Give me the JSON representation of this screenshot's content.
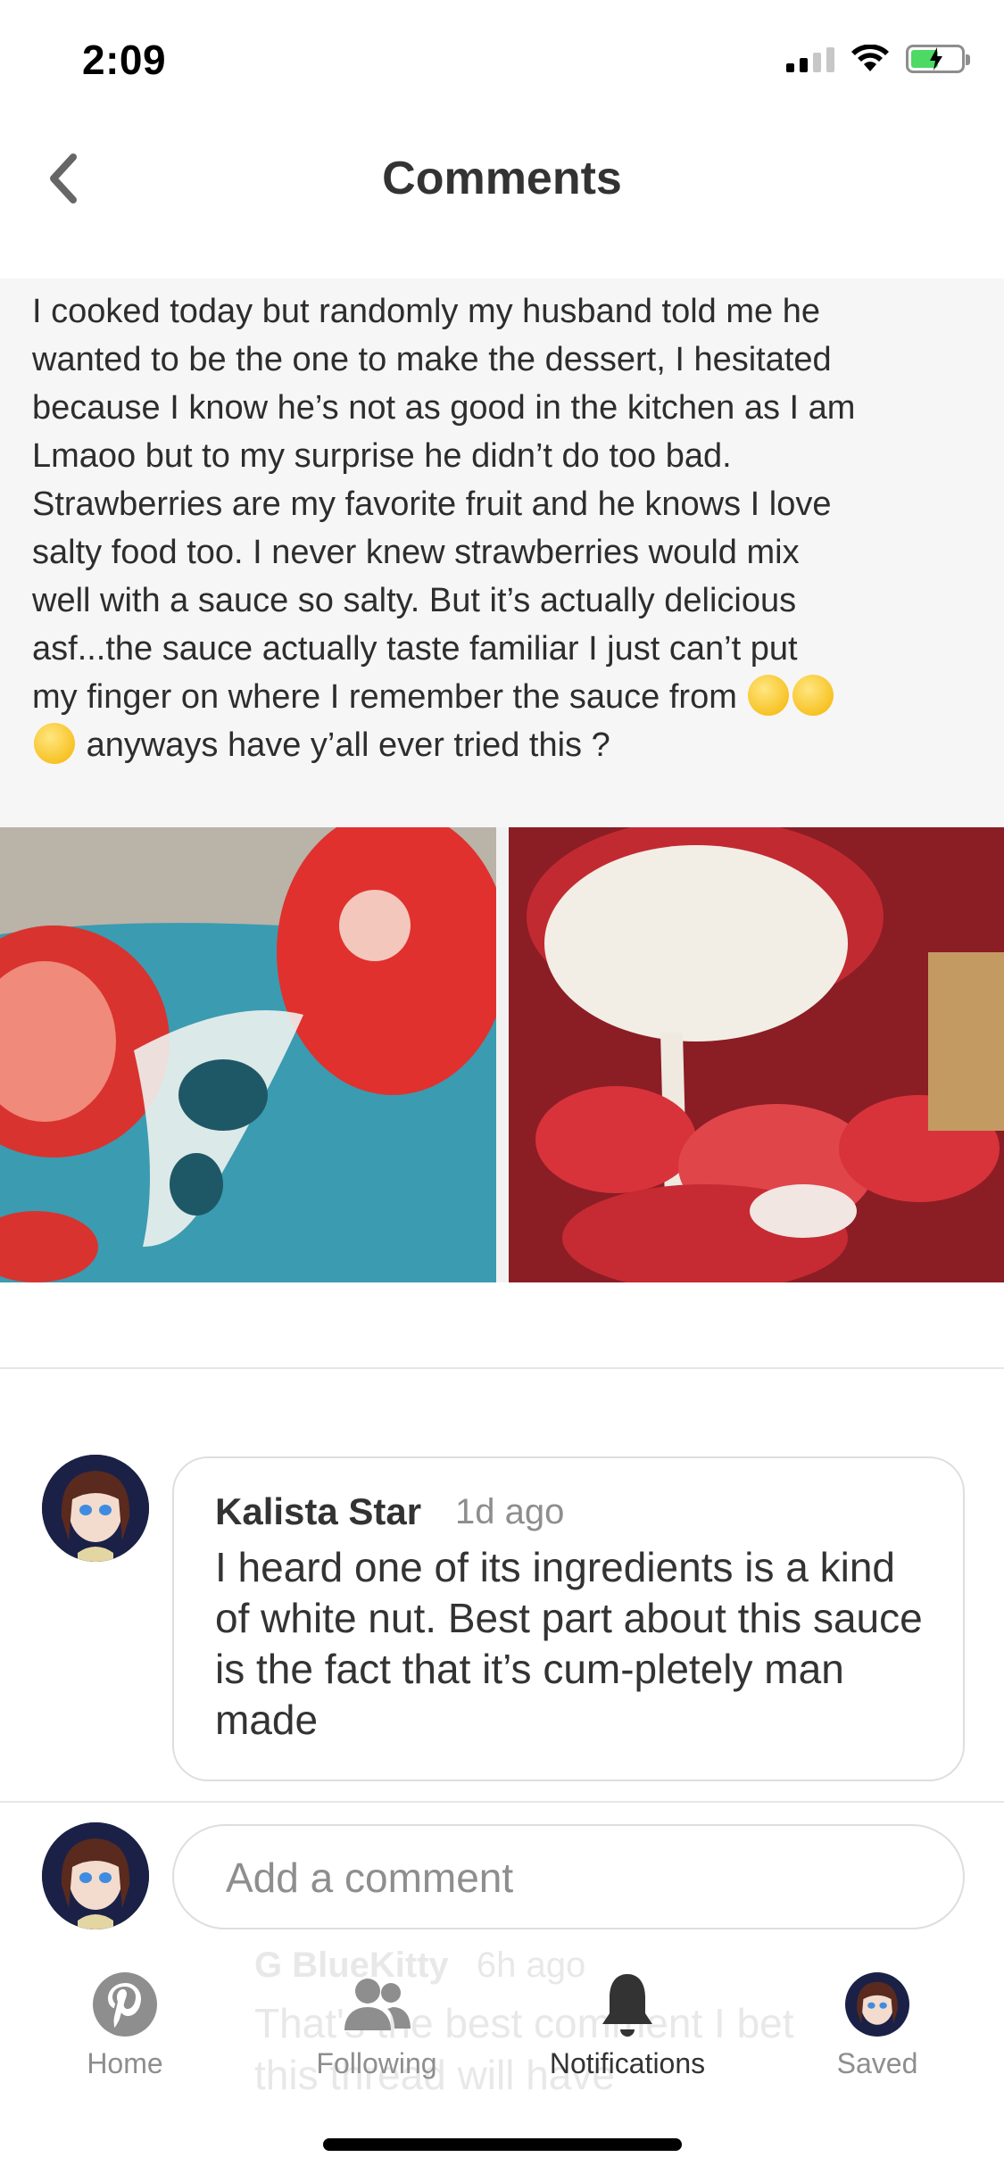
{
  "status_bar": {
    "time": "2:09"
  },
  "header": {
    "title": "Comments"
  },
  "post": {
    "caption_lines": [
      "I cooked today but randomly my husband told me he",
      "wanted to be the one to make the dessert, I hesitated",
      "because I know he’s not as good in the kitchen as I am",
      "Lmaoo but to my surprise he didn’t do too bad.",
      "Strawberries are my favorite fruit and he knows I love",
      "salty food too. I never knew strawberries would mix",
      "well with a sauce so salty. But it’s actually delicious",
      "asf...the sauce actually taste familiar I just can’t put",
      "my finger on where I remember the sauce from",
      "anyways have y’all ever tried this ?"
    ]
  },
  "comment": {
    "author": "Kalista Star",
    "time": "1d ago",
    "body": "I heard one of its ingredients is a kind of white nut. Best part about this sauce is the fact that it’s cum-pletely man made"
  },
  "faded_comment": {
    "author": "G BlueKitty",
    "time": "6h ago",
    "body_line1": "That's the best comment I bet",
    "body_line2": "this thread will have"
  },
  "add_comment": {
    "placeholder": "Add a comment"
  },
  "tabs": [
    {
      "label": "Home",
      "icon": "pinterest-icon"
    },
    {
      "label": "Following",
      "icon": "people-icon"
    },
    {
      "label": "Notifications",
      "icon": "bell-icon"
    },
    {
      "label": "Saved",
      "icon": "avatar-icon"
    }
  ],
  "colors": {
    "text_dark": "#333333",
    "text_muted": "#8e8e8e",
    "border": "#dedede",
    "battery_green": "#4cd964"
  }
}
